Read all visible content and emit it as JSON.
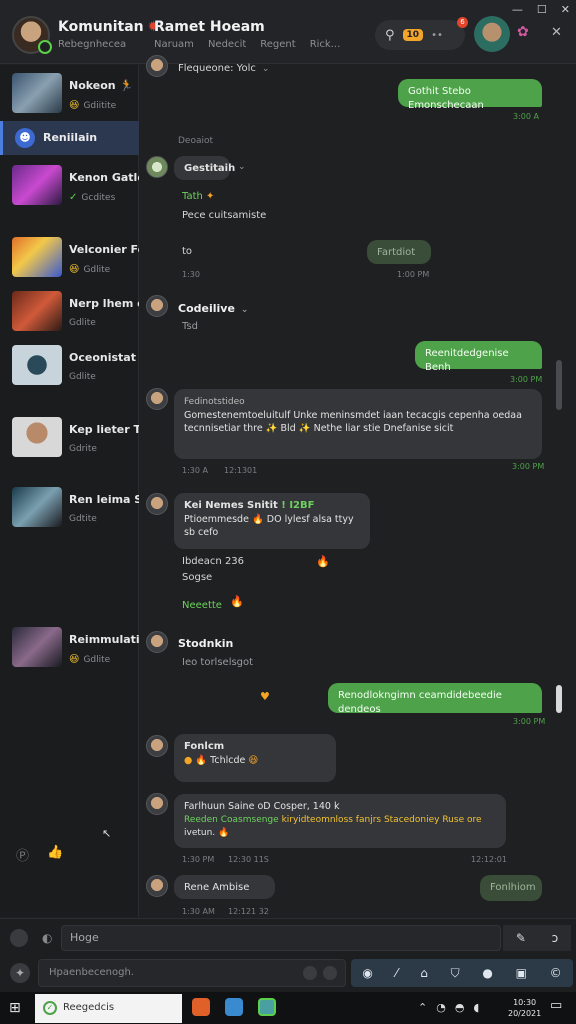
{
  "window": {
    "controls": [
      "—",
      "☐",
      "✕"
    ]
  },
  "header": {
    "title": "Komunitan",
    "subtitle": "Rebegnhecea",
    "chat_name": "Ramet Hoeam",
    "tabs": [
      "Naruam",
      "Nedecit",
      "Regent",
      "Rick..."
    ],
    "search_badge": "10",
    "notif_count": "6"
  },
  "sidebar": {
    "items": [
      {
        "name": "Nokeon 🏃",
        "meta": "Gdiitite",
        "emoji": "😆"
      },
      {
        "name": "Kenon Gatley",
        "meta": "Gcdites",
        "emoji": "✓"
      },
      {
        "name": "Velconier Foc",
        "meta": "Gdlite",
        "emoji": "😆"
      },
      {
        "name": "Nerp lhem ot",
        "meta": "Gdlite",
        "emoji": ""
      },
      {
        "name": "Oceonistat",
        "meta": "Gdlite",
        "emoji": ""
      },
      {
        "name": "Kep lieter Tot",
        "meta": "Gdrite",
        "emoji": ""
      },
      {
        "name": "Ren leima S",
        "meta": "Gdtite",
        "emoji": ""
      },
      {
        "name": "Reimmulatis",
        "meta": "Gdlite",
        "emoji": "😆"
      }
    ],
    "active": "Reniilain"
  },
  "chat": {
    "top_sender": "Flequeone: Yolc",
    "out1": {
      "text": "Gothit Stebo Emonschecaan",
      "time": "3:00 A"
    },
    "date_sep": "Deoaiot",
    "m1": {
      "sender": "Gestitaih",
      "lines": [
        "Tath",
        "Pece cuitsamiste",
        "to"
      ],
      "time": "1:30",
      "dim_out": "Fartdiot",
      "dim_time": "1:00 PM"
    },
    "m2": {
      "sender": "Codeilive",
      "sub": "Tsd"
    },
    "out2": {
      "text": "Reenitdedgenise Benh",
      "time": "3:00 PM"
    },
    "m3": {
      "sender": "Fedinotstideo",
      "text": "Gomestenemtoeluitulf Unke meninsmdet iaan tecacgis cepenha oedaa tecnnisetiar thre ✨ Bld ✨ Nethe liar stie Dnefanise sicit",
      "time": "1:30 A",
      "time2": "12:1301",
      "out_time": "3:00 PM"
    },
    "m4": {
      "sender": "Kei Nemes Snitit",
      "tag": "! I2BF",
      "text": "Ptioemmesde 🔥 DO lylesf alsa ttyy sb cefo",
      "line2": "Ibdeacn 236",
      "line3": "Sogse",
      "line4": "Neeette"
    },
    "m5": {
      "sender": "Stodnkin",
      "sub": "Ieo torlselsgot"
    },
    "out3": {
      "text": "Renodlokngimn ceamdidebeedie dendeos",
      "time": "3:00 PM"
    },
    "m6": {
      "sender": "Fonlcm",
      "text": "Tchlcde"
    },
    "m7": {
      "sender": "Farlhuun Saine oD Cosper, 140 k",
      "text1": "Reeden Coasmsenge",
      "text2": "kiryidteomnloss fanjrs Stacedoniey Ruse ore",
      "text3": "ivetun.",
      "time": "1:30 PM",
      "time2": "12:30 11S",
      "time3": "12:12:01"
    },
    "m8": {
      "sender": "Rene Ambise",
      "time": "1:30 AM",
      "time2": "12:121 32",
      "dim_out": "Fonlhiom"
    }
  },
  "composer": {
    "input1": "Hoge",
    "input2": "Hpaenbecenogh."
  },
  "taskbar": {
    "search": "Reegedcis",
    "clock": [
      "10:30",
      "20/2021"
    ]
  }
}
